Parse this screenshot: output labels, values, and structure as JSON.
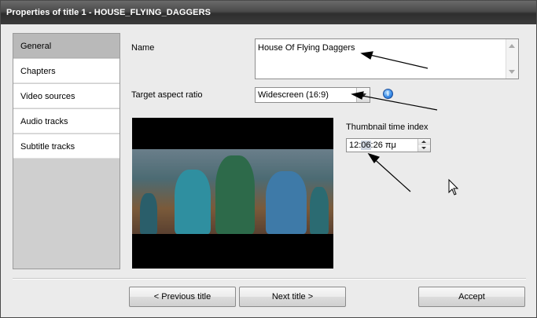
{
  "window": {
    "title": "Properties of title 1 - HOUSE_FLYING_DAGGERS"
  },
  "sidebar": {
    "items": [
      {
        "label": "General",
        "active": true
      },
      {
        "label": "Chapters"
      },
      {
        "label": "Video sources"
      },
      {
        "label": "Audio tracks"
      },
      {
        "label": "Subtitle tracks"
      }
    ]
  },
  "form": {
    "name_label": "Name",
    "name_value": "House Of Flying Daggers",
    "aspect_label": "Target aspect ratio",
    "aspect_value": "Widescreen (16:9)",
    "thumb_label": "Thumbnail time index",
    "thumb_value_a": "12:",
    "thumb_value_b": "06",
    "thumb_value_c": ":26 πμ"
  },
  "buttons": {
    "prev": "< Previous title",
    "next": "Next title >",
    "accept": "Accept"
  },
  "icons": {
    "info": "info-icon",
    "cursor": "mouse-cursor-icon",
    "annotation": "arrow-annotation"
  },
  "colors": {
    "titlebar": "#3b3b3b",
    "active_nav": "#b9b9b9",
    "info": "#3b8ee8"
  }
}
